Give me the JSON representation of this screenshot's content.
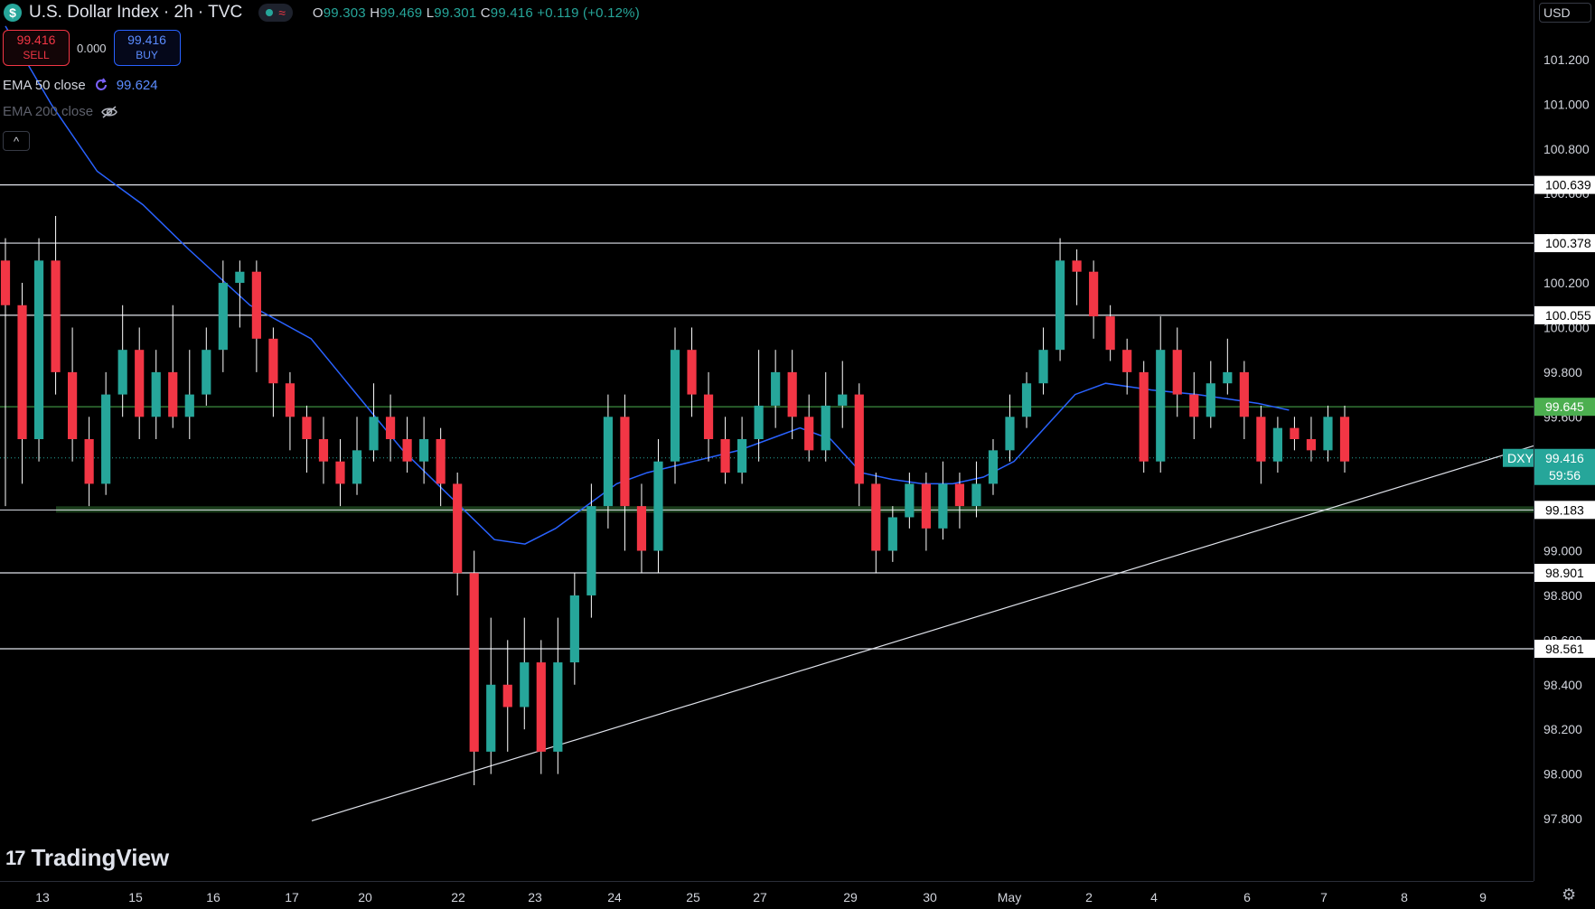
{
  "header": {
    "symbol_icon": "$",
    "title": "U.S. Dollar Index · 2h · TVC",
    "status_icon": "≈",
    "ohlc": {
      "o_label": "O",
      "o": "99.303",
      "h_label": "H",
      "h": "99.469",
      "l_label": "L",
      "l": "99.301",
      "c_label": "C",
      "c": "99.416",
      "change": "+0.119 (+0.12%)"
    }
  },
  "trade": {
    "sell_price": "99.416",
    "sell_label": "SELL",
    "spread": "0.000",
    "buy_price": "99.416",
    "buy_label": "BUY"
  },
  "indicators": [
    {
      "label": "EMA 50 close",
      "value": "99.624",
      "icon": "refresh-icon"
    },
    {
      "label": "EMA 200 close",
      "icon": "eye-off-icon"
    }
  ],
  "currency": "USD",
  "brand": "TradingView",
  "colors": {
    "up": "#26a69a",
    "down": "#f23645",
    "ema": "#2962ff",
    "support": "#4caf50"
  },
  "chart_data": {
    "type": "candlestick",
    "symbol": "DXY",
    "interval": "2h",
    "ylim": [
      97.75,
      101.35
    ],
    "y_ticks": [
      "101.200",
      "101.000",
      "100.800",
      "100.600",
      "100.400",
      "100.200",
      "100.000",
      "99.800",
      "99.600",
      "99.400",
      "99.200",
      "99.000",
      "98.800",
      "98.600",
      "98.400",
      "98.200",
      "98.000",
      "97.800"
    ],
    "x_ticks": [
      "13",
      "15",
      "16",
      "17",
      "20",
      "22",
      "23",
      "24",
      "25",
      "27",
      "29",
      "30",
      "May",
      "2",
      "4",
      "6",
      "7",
      "8",
      "9"
    ],
    "horizontal_levels": [
      {
        "value": 100.639,
        "label": "100.639"
      },
      {
        "value": 100.378,
        "label": "100.378"
      },
      {
        "value": 100.055,
        "label": "100.055"
      },
      {
        "value": 99.645,
        "label": "99.645",
        "style": "green"
      },
      {
        "value": 99.183,
        "label": "99.183",
        "style": "support-band"
      },
      {
        "value": 98.901,
        "label": "98.901"
      },
      {
        "value": 98.561,
        "label": "98.561"
      }
    ],
    "last_price": {
      "value": 99.416,
      "label": "99.416",
      "symbol": "DXY",
      "countdown": "59:56"
    },
    "trendline": {
      "from": {
        "bar": 0.0,
        "price": 97.79
      },
      "to": {
        "bar": 1.0,
        "price": 99.47
      }
    },
    "ema50": [
      [
        0.0,
        101.35
      ],
      [
        0.03,
        101.0
      ],
      [
        0.06,
        100.7
      ],
      [
        0.09,
        100.55
      ],
      [
        0.12,
        100.35
      ],
      [
        0.16,
        100.1
      ],
      [
        0.2,
        99.95
      ],
      [
        0.23,
        99.7
      ],
      [
        0.26,
        99.45
      ],
      [
        0.29,
        99.25
      ],
      [
        0.32,
        99.05
      ],
      [
        0.34,
        99.03
      ],
      [
        0.36,
        99.1
      ],
      [
        0.38,
        99.2
      ],
      [
        0.4,
        99.3
      ],
      [
        0.42,
        99.35
      ],
      [
        0.45,
        99.4
      ],
      [
        0.48,
        99.45
      ],
      [
        0.5,
        99.5
      ],
      [
        0.52,
        99.55
      ],
      [
        0.54,
        99.5
      ],
      [
        0.56,
        99.35
      ],
      [
        0.58,
        99.32
      ],
      [
        0.6,
        99.3
      ],
      [
        0.62,
        99.3
      ],
      [
        0.64,
        99.33
      ],
      [
        0.66,
        99.4
      ],
      [
        0.68,
        99.55
      ],
      [
        0.7,
        99.7
      ],
      [
        0.72,
        99.75
      ],
      [
        0.75,
        99.72
      ],
      [
        0.78,
        99.7
      ],
      [
        0.8,
        99.68
      ],
      [
        0.82,
        99.66
      ],
      [
        0.84,
        99.63
      ]
    ],
    "candles": [
      [
        100.3,
        100.1,
        100.4,
        99.2
      ],
      [
        100.1,
        99.5,
        100.2,
        99.3
      ],
      [
        99.5,
        100.3,
        100.4,
        99.4
      ],
      [
        100.3,
        99.8,
        100.5,
        99.7
      ],
      [
        99.8,
        99.5,
        100.0,
        99.4
      ],
      [
        99.5,
        99.3,
        99.6,
        99.2
      ],
      [
        99.3,
        99.7,
        99.8,
        99.25
      ],
      [
        99.7,
        99.9,
        100.1,
        99.6
      ],
      [
        99.9,
        99.6,
        100.0,
        99.5
      ],
      [
        99.6,
        99.8,
        99.9,
        99.5
      ],
      [
        99.8,
        99.6,
        100.1,
        99.55
      ],
      [
        99.6,
        99.7,
        99.9,
        99.5
      ],
      [
        99.7,
        99.9,
        100.0,
        99.65
      ],
      [
        99.9,
        100.2,
        100.3,
        99.8
      ],
      [
        100.2,
        100.25,
        100.3,
        100.0
      ],
      [
        100.25,
        99.95,
        100.3,
        99.8
      ],
      [
        99.95,
        99.75,
        100.0,
        99.6
      ],
      [
        99.75,
        99.6,
        99.8,
        99.45
      ],
      [
        99.6,
        99.5,
        99.65,
        99.35
      ],
      [
        99.5,
        99.4,
        99.6,
        99.3
      ],
      [
        99.4,
        99.3,
        99.5,
        99.2
      ],
      [
        99.3,
        99.45,
        99.6,
        99.25
      ],
      [
        99.45,
        99.6,
        99.75,
        99.4
      ],
      [
        99.6,
        99.5,
        99.7,
        99.4
      ],
      [
        99.5,
        99.4,
        99.6,
        99.35
      ],
      [
        99.4,
        99.5,
        99.6,
        99.3
      ],
      [
        99.5,
        99.3,
        99.55,
        99.2
      ],
      [
        99.3,
        98.9,
        99.35,
        98.8
      ],
      [
        98.9,
        98.1,
        99.0,
        97.95
      ],
      [
        98.1,
        98.4,
        98.7,
        98.0
      ],
      [
        98.4,
        98.3,
        98.6,
        98.1
      ],
      [
        98.3,
        98.5,
        98.7,
        98.2
      ],
      [
        98.5,
        98.1,
        98.6,
        98.0
      ],
      [
        98.1,
        98.5,
        98.7,
        98.0
      ],
      [
        98.5,
        98.8,
        98.9,
        98.4
      ],
      [
        98.8,
        99.2,
        99.3,
        98.7
      ],
      [
        99.2,
        99.6,
        99.7,
        99.1
      ],
      [
        99.6,
        99.2,
        99.7,
        99.0
      ],
      [
        99.2,
        99.0,
        99.3,
        98.9
      ],
      [
        99.0,
        99.4,
        99.5,
        98.9
      ],
      [
        99.4,
        99.9,
        100.0,
        99.3
      ],
      [
        99.9,
        99.7,
        100.0,
        99.6
      ],
      [
        99.7,
        99.5,
        99.8,
        99.4
      ],
      [
        99.5,
        99.35,
        99.6,
        99.3
      ],
      [
        99.35,
        99.5,
        99.6,
        99.3
      ],
      [
        99.5,
        99.65,
        99.9,
        99.4
      ],
      [
        99.65,
        99.8,
        99.9,
        99.55
      ],
      [
        99.8,
        99.6,
        99.9,
        99.5
      ],
      [
        99.6,
        99.45,
        99.7,
        99.4
      ],
      [
        99.45,
        99.65,
        99.8,
        99.4
      ],
      [
        99.65,
        99.7,
        99.85,
        99.55
      ],
      [
        99.7,
        99.3,
        99.75,
        99.2
      ],
      [
        99.3,
        99.0,
        99.35,
        98.9
      ],
      [
        99.0,
        99.15,
        99.2,
        98.95
      ],
      [
        99.15,
        99.3,
        99.35,
        99.1
      ],
      [
        99.3,
        99.1,
        99.35,
        99.0
      ],
      [
        99.1,
        99.3,
        99.4,
        99.05
      ],
      [
        99.3,
        99.2,
        99.35,
        99.1
      ],
      [
        99.2,
        99.3,
        99.4,
        99.15
      ],
      [
        99.3,
        99.45,
        99.5,
        99.25
      ],
      [
        99.45,
        99.6,
        99.7,
        99.4
      ],
      [
        99.6,
        99.75,
        99.8,
        99.55
      ],
      [
        99.75,
        99.9,
        100.0,
        99.7
      ],
      [
        99.9,
        100.3,
        100.4,
        99.85
      ],
      [
        100.3,
        100.25,
        100.35,
        100.1
      ],
      [
        100.25,
        100.05,
        100.3,
        99.95
      ],
      [
        100.05,
        99.9,
        100.1,
        99.85
      ],
      [
        99.9,
        99.8,
        99.95,
        99.7
      ],
      [
        99.8,
        99.4,
        99.85,
        99.35
      ],
      [
        99.4,
        99.9,
        100.05,
        99.35
      ],
      [
        99.9,
        99.7,
        100.0,
        99.6
      ],
      [
        99.7,
        99.6,
        99.8,
        99.5
      ],
      [
        99.6,
        99.75,
        99.85,
        99.55
      ],
      [
        99.75,
        99.8,
        99.95,
        99.7
      ],
      [
        99.8,
        99.6,
        99.85,
        99.5
      ],
      [
        99.6,
        99.4,
        99.65,
        99.3
      ],
      [
        99.4,
        99.55,
        99.6,
        99.35
      ],
      [
        99.55,
        99.5,
        99.6,
        99.45
      ],
      [
        99.5,
        99.45,
        99.6,
        99.4
      ],
      [
        99.45,
        99.6,
        99.65,
        99.4
      ],
      [
        99.6,
        99.4,
        99.65,
        99.35
      ]
    ]
  }
}
